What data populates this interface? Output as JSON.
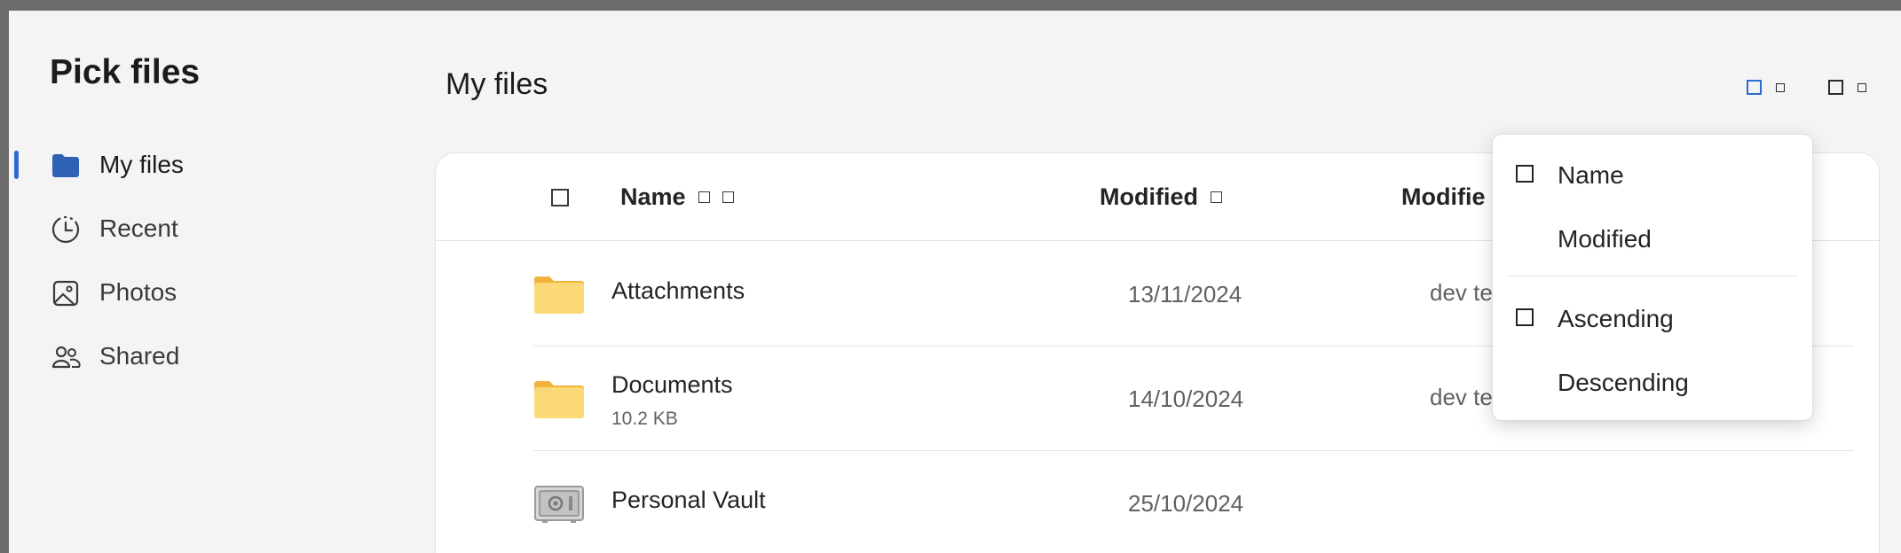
{
  "app": {
    "title": "Pick files"
  },
  "sidebar": {
    "items": [
      {
        "label": "My files",
        "icon": "folder-icon",
        "active": true
      },
      {
        "label": "Recent",
        "icon": "clock-icon",
        "active": false
      },
      {
        "label": "Photos",
        "icon": "photo-icon",
        "active": false
      },
      {
        "label": "Shared",
        "icon": "people-icon",
        "active": false
      }
    ]
  },
  "main": {
    "title": "My files",
    "toolbar": {
      "view_icon": "view-icon",
      "sort_icon": "sort-icon"
    }
  },
  "table": {
    "columns": {
      "name": "Name",
      "modified": "Modified",
      "modified_by": "Modifie"
    },
    "rows": [
      {
        "name": "Attachments",
        "size": "",
        "modified": "13/11/2024",
        "modified_by": "dev test",
        "icon": "folder-icon"
      },
      {
        "name": "Documents",
        "size": "10.2 KB",
        "modified": "14/10/2024",
        "modified_by": "dev test",
        "icon": "folder-icon"
      },
      {
        "name": "Personal Vault",
        "size": "",
        "modified": "25/10/2024",
        "modified_by": "",
        "icon": "vault-icon"
      }
    ]
  },
  "sort_menu": {
    "items": [
      {
        "label": "Name",
        "checked": true
      },
      {
        "label": "Modified",
        "checked": false
      },
      {
        "label": "Ascending",
        "checked": true
      },
      {
        "label": "Descending",
        "checked": false
      }
    ]
  },
  "colors": {
    "accent": "#2e6bd1",
    "folder": "#fbd976",
    "folder_tab": "#f2b33d",
    "background": "#f4f4f4"
  }
}
